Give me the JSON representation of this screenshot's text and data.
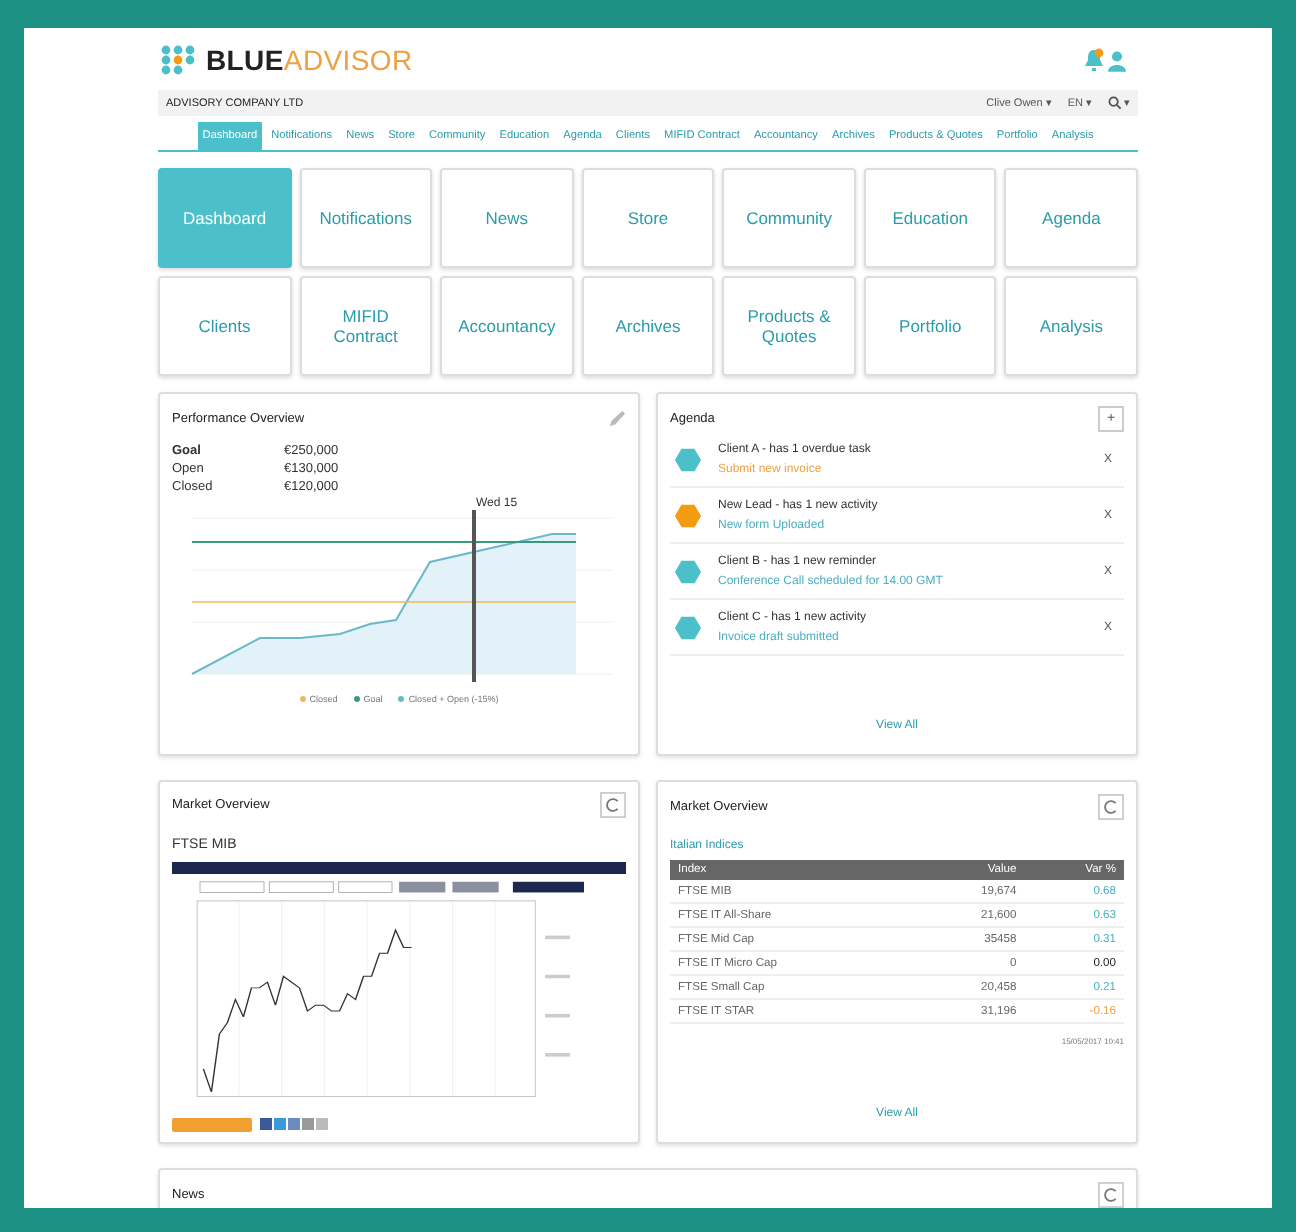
{
  "brand": {
    "part1": "BLUE",
    "part2": "ADVISOR"
  },
  "company": "ADVISORY COMPANY LTD",
  "user": {
    "name": "Clive Owen ▾",
    "language": "EN ▾",
    "search": "▾"
  },
  "nav": [
    {
      "label": "Dashboard",
      "selected": true
    },
    {
      "label": "Notifications",
      "selected": false
    },
    {
      "label": "News",
      "selected": false
    },
    {
      "label": "Store",
      "selected": false
    },
    {
      "label": "Community",
      "selected": false
    },
    {
      "label": "Education",
      "selected": false
    },
    {
      "label": "Agenda",
      "selected": false
    },
    {
      "label": "Clients",
      "selected": false
    },
    {
      "label": "MIFID Contract",
      "selected": false
    },
    {
      "label": "Accountancy",
      "selected": false
    },
    {
      "label": "Archives",
      "selected": false
    },
    {
      "label": "Products & Quotes",
      "selected": false
    },
    {
      "label": "Portfolio",
      "selected": false
    },
    {
      "label": "Analysis",
      "selected": false
    }
  ],
  "tiles": [
    {
      "label": "Dashboard",
      "selected": true
    },
    {
      "label": "Notifications",
      "selected": false
    },
    {
      "label": "News",
      "selected": false
    },
    {
      "label": "Store",
      "selected": false
    },
    {
      "label": "Community",
      "selected": false
    },
    {
      "label": "Education",
      "selected": false
    },
    {
      "label": "Agenda",
      "selected": false
    },
    {
      "label": "Clients",
      "selected": false
    },
    {
      "label": "MIFID Contract",
      "selected": false
    },
    {
      "label": "Accountancy",
      "selected": false
    },
    {
      "label": "Archives",
      "selected": false
    },
    {
      "label": "Products & Quotes",
      "selected": false
    },
    {
      "label": "Portfolio",
      "selected": false
    },
    {
      "label": "Analysis",
      "selected": false
    }
  ],
  "performance": {
    "title": "Performance Overview",
    "figures": [
      {
        "label": "Goal",
        "value": "€250,000",
        "bold": true
      },
      {
        "label": "Open",
        "value": "€130,000",
        "bold": false
      },
      {
        "label": "Closed",
        "value": "€120,000",
        "bold": false
      }
    ],
    "marker": "Wed 15",
    "legend": [
      {
        "label": "Closed",
        "color": "#f0b860"
      },
      {
        "label": "Goal",
        "color": "#3a9a80"
      },
      {
        "label": "Closed + Open (-15%)",
        "color": "#6ab8c8"
      }
    ]
  },
  "agenda": {
    "title": "Agenda",
    "add": "+",
    "items": [
      {
        "title": "Client A - has 1 overdue task",
        "note": "Submit new invoice",
        "color": "#4bbfca",
        "overdue": true,
        "close": "X"
      },
      {
        "title": "New Lead - has 1 new activity",
        "note": "New form Uploaded",
        "color": "#f39c12",
        "overdue": false,
        "close": "X"
      },
      {
        "title": "Client B - has 1 new reminder",
        "note": "Conference Call scheduled for 14.00 GMT",
        "color": "#4bbfca",
        "overdue": false,
        "close": "X"
      },
      {
        "title": "Client C - has 1 new activity",
        "note": "Invoice draft submitted",
        "color": "#4bbfca",
        "overdue": false,
        "close": "X"
      }
    ],
    "link": "View All"
  },
  "market_chart": {
    "title": "Market Overview",
    "symbol": "FTSE MIB"
  },
  "market_table": {
    "title": "Market Overview",
    "subtitle": "Italian Indices",
    "columns": [
      "Index",
      "Value",
      "Var %"
    ],
    "rows": [
      {
        "index": "FTSE MIB",
        "value": "19,674",
        "var": "0.68",
        "color": "#4aaec0"
      },
      {
        "index": "FTSE IT All-Share",
        "value": "21,600",
        "var": "0.63",
        "color": "#4aaec0"
      },
      {
        "index": "FTSE Mid Cap",
        "value": "35458",
        "var": "0.31",
        "color": "#4aaec0"
      },
      {
        "index": "FTSE IT Micro Cap",
        "value": "0",
        "var": "0.00",
        "color": "#222222"
      },
      {
        "index": "FTSE Small Cap",
        "value": "20,458",
        "var": "0.21",
        "color": "#4aaec0"
      },
      {
        "index": "FTSE IT STAR",
        "value": "31,196",
        "var": "-0.16",
        "color": "#f0a040"
      }
    ],
    "timestamp": "15/05/2017 10:41",
    "link": "View All"
  },
  "news": {
    "title": "News"
  }
}
